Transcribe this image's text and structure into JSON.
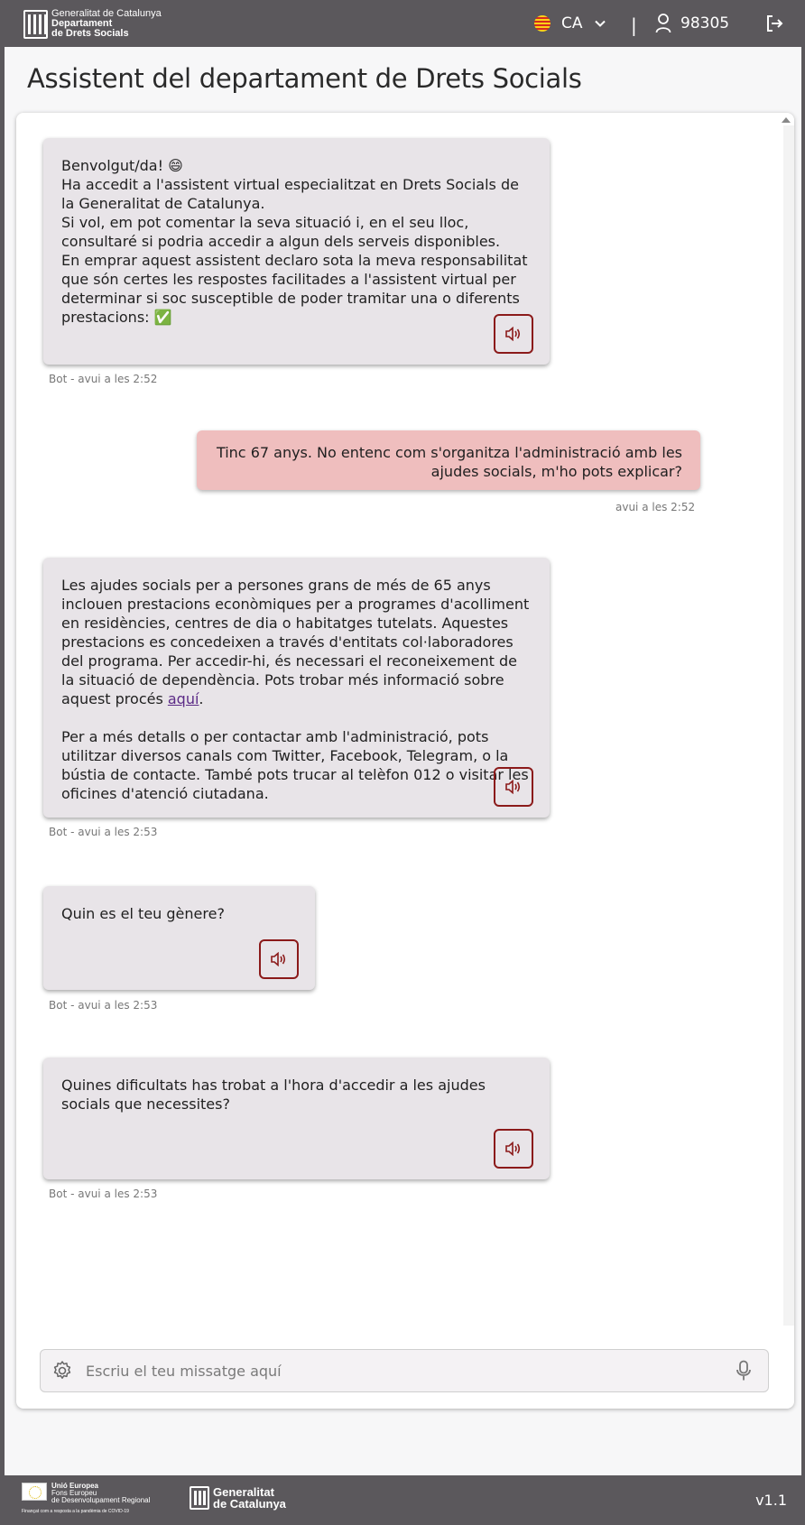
{
  "header": {
    "logo_line1": "Generalitat de Catalunya",
    "logo_line2": "Departament",
    "logo_line3": "de Drets Socials",
    "language": "CA",
    "separator": "|",
    "user_id": "98305"
  },
  "page_title": "Assistent del departament de Drets Socials",
  "messages": [
    {
      "sender": "bot",
      "text": "Benvolgut/da! 😄\nHa accedit a l'assistent virtual especialitzat en Drets Socials de la Generalitat de Catalunya.\nSi vol, em pot comentar la seva situació i, en el seu lloc, consultaré si podria accedir a algun dels serveis disponibles.\nEn emprar aquest assistent declaro sota la meva responsabilitat que són certes les respostes facilitades a l'assistent virtual per determinar si soc susceptible de poder tramitar una o diferents prestacions: ✅",
      "meta": "Bot - avui a les 2:52"
    },
    {
      "sender": "user",
      "text": "Tinc 67 anys. No entenc com s'organitza l'administració amb les ajudes socials, m'ho pots explicar?",
      "meta": "avui a les 2:52"
    },
    {
      "sender": "bot",
      "text_part1": "Les ajudes socials per a persones grans de més de 65 anys inclouen prestacions econòmiques per a programes d'acolliment en residències, centres de dia o habitatges tutelats. Aquestes prestacions es concedeixen a través d'entitats col·laboradores del programa. Per accedir-hi, és necessari el reconeixement de la situació de dependència. Pots trobar més informació sobre aquest procés ",
      "link_text": "aquí",
      "text_part2": ".",
      "text_part3": "Per a més detalls o per contactar amb l'administració, pots utilitzar diversos canals com Twitter, Facebook, Telegram, o la bústia de contacte. També pots trucar al telèfon 012 o visitar les oficines d'atenció ciutadana.",
      "meta": "Bot - avui a les 2:53"
    },
    {
      "sender": "bot",
      "text": "Quin es el teu gènere?",
      "meta": "Bot - avui a les 2:53"
    },
    {
      "sender": "bot",
      "text": "Quines dificultats has trobat a l'hora d'accedir a les ajudes socials que necessites?",
      "meta": "Bot - avui a les 2:53"
    }
  ],
  "input": {
    "placeholder": "Escriu el teu missatge aquí",
    "value": ""
  },
  "footer": {
    "eu_line1": "Unió Europea",
    "eu_line2": "Fons Europeu",
    "eu_line3": "de Desenvolupament Regional",
    "eu_subtitle": "Finançat com a resposta a la pandèmia de COVID-19",
    "gen_line1": "Generalitat",
    "gen_line2": "de Catalunya",
    "version": "v1.1"
  },
  "colors": {
    "header_bg": "#5b585c",
    "bot_bubble": "#e8e4e8",
    "user_bubble": "#efbebe",
    "accent": "#8b1a1a",
    "link": "#5b2a86"
  },
  "icons": [
    "flag-icon",
    "chevron-down-icon",
    "user-icon",
    "logout-icon",
    "speaker-icon",
    "gear-icon",
    "microphone-icon"
  ]
}
